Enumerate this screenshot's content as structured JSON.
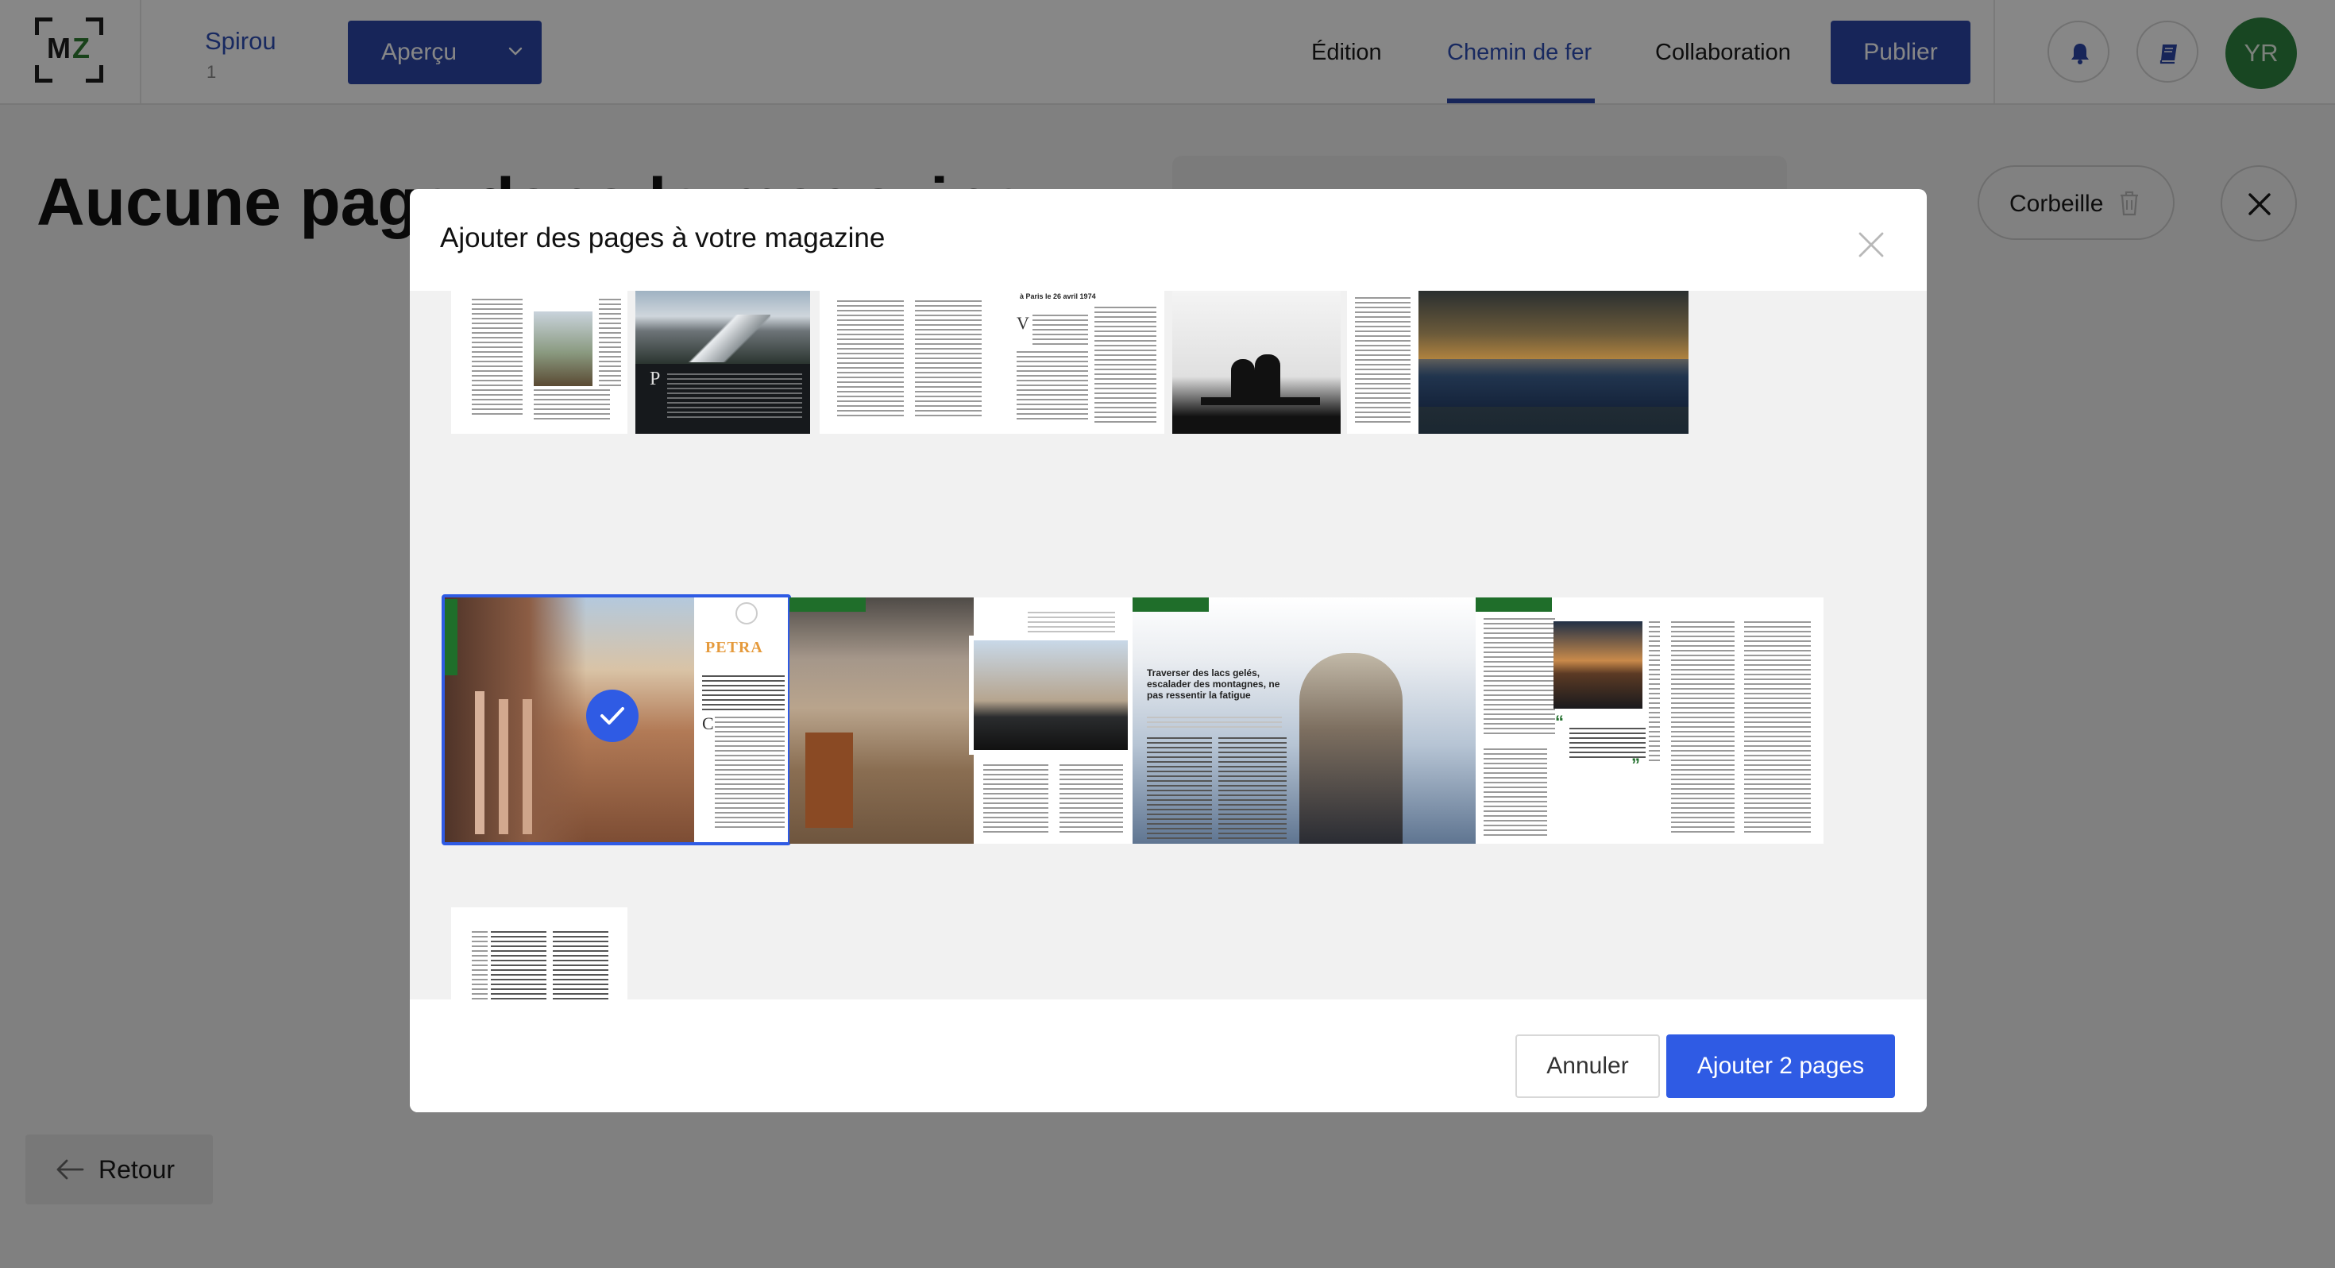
{
  "header": {
    "logo_text_m": "M",
    "logo_text_z": "Z",
    "project_name": "Spirou",
    "project_number": "1",
    "preview_label": "Aperçu",
    "nav": [
      "Édition",
      "Chemin de fer",
      "Collaboration"
    ],
    "active_nav": "Chemin de fer",
    "publish_label": "Publier",
    "icons": [
      "bell-icon",
      "book-icon"
    ],
    "avatar_initials": "YR"
  },
  "page": {
    "title": "Aucune page dans le magazine",
    "trash_label": "Corbeille",
    "back_label": "Retour"
  },
  "modal": {
    "title": "Ajouter des pages à votre magazine",
    "cancel_label": "Annuler",
    "confirm_label": "Ajouter 2 pages",
    "petra_heading": "PETRA",
    "spread_headline": "Traverser des lacs gelés, escalader des montagnes, ne pas ressentir la fatigue",
    "selected_spread": 1
  },
  "colors": {
    "primary": "#2d47a8",
    "primary_bright": "#2f5be4",
    "brand_green": "#2e7d32",
    "avatar_green": "#2e8540",
    "category_green": "#1f6e2a"
  }
}
